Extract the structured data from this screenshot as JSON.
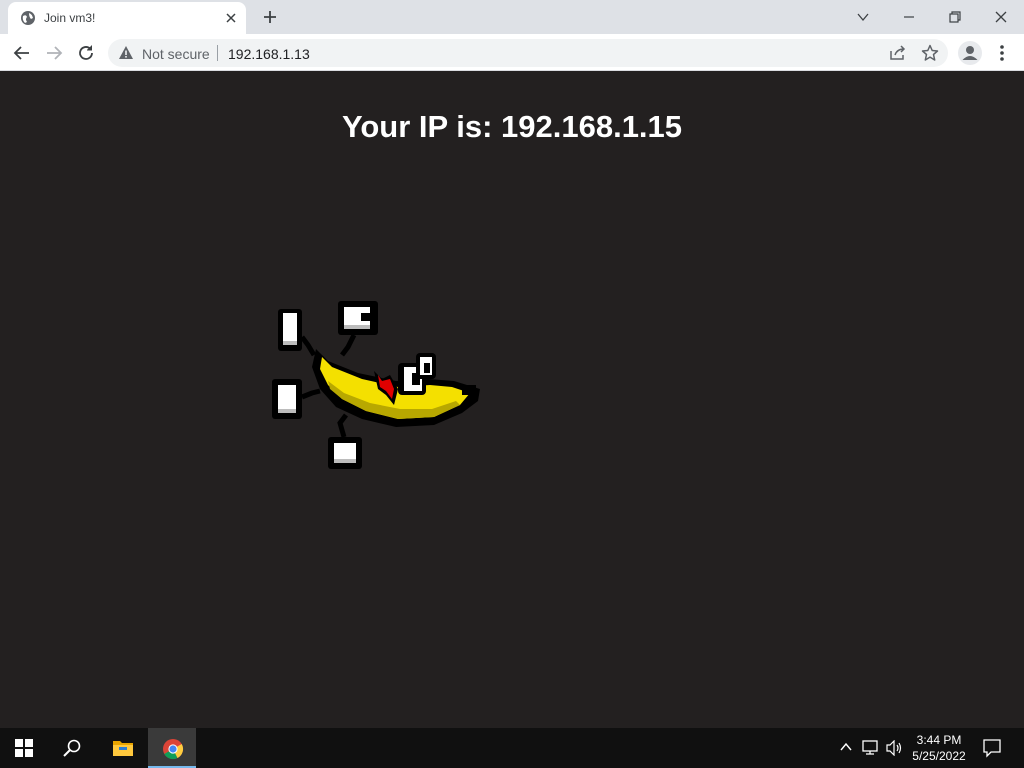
{
  "browser": {
    "tab_title": "Join vm3!",
    "security_label": "Not secure",
    "url": "192.168.1.13"
  },
  "page": {
    "heading": "Your IP is: 192.168.1.15",
    "background_color": "#232020",
    "heading_color": "#ffffff",
    "image_icon": "dancing-banana-icon"
  },
  "taskbar": {
    "time": "3:44 PM",
    "date": "5/25/2022",
    "apps": [
      "start-icon",
      "search-icon",
      "file-explorer-icon",
      "chrome-icon"
    ],
    "tray": [
      "chevron-up-icon",
      "network-icon",
      "volume-icon",
      "notification-icon"
    ]
  }
}
